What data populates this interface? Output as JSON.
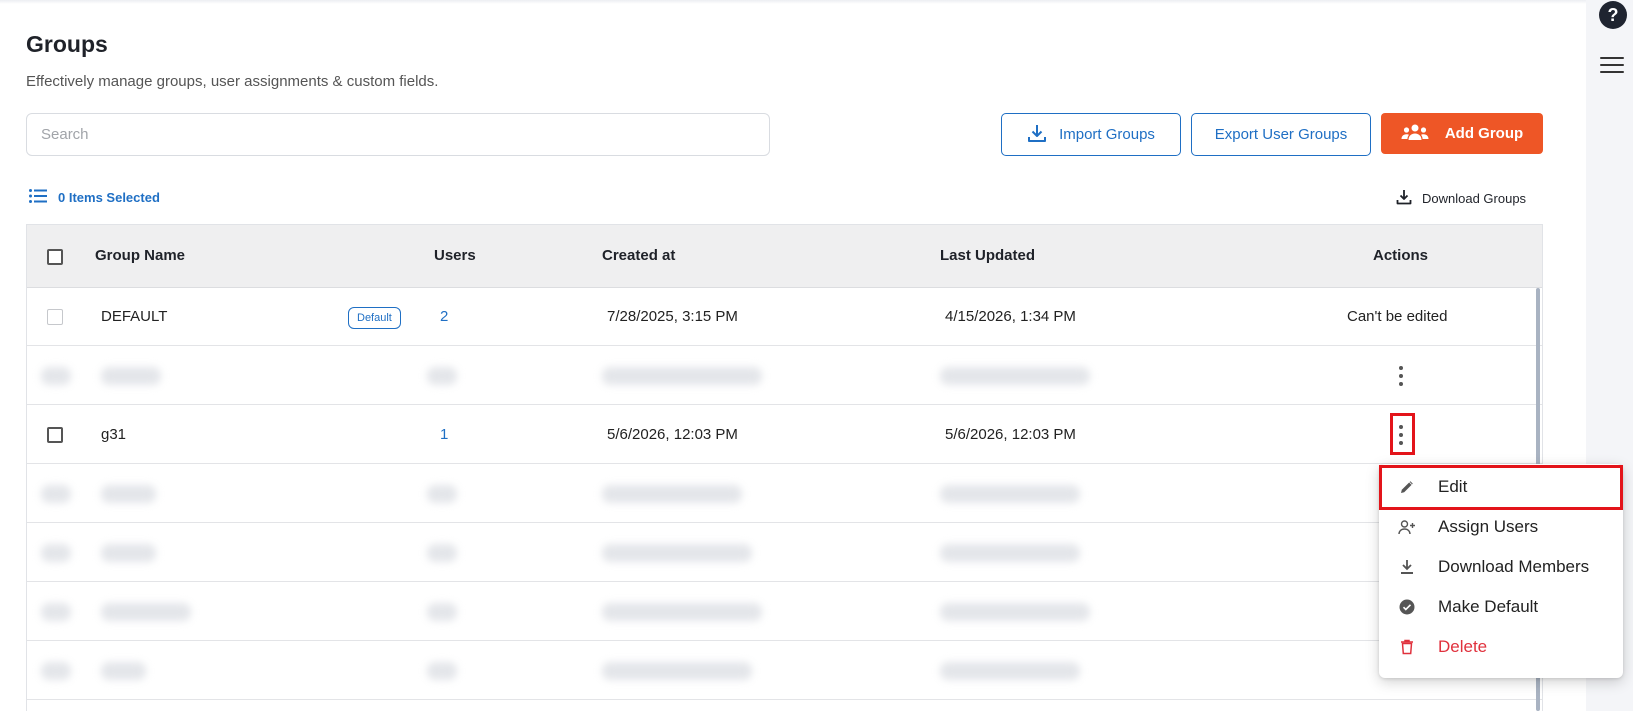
{
  "page": {
    "title": "Groups",
    "subtitle": "Effectively manage groups, user assignments & custom fields."
  },
  "search": {
    "placeholder": "Search",
    "value": ""
  },
  "toolbar": {
    "import_label": "Import Groups",
    "export_label": "Export User Groups",
    "add_label": "Add Group",
    "items_selected": "0 Items Selected",
    "download_label": "Download Groups"
  },
  "table": {
    "headers": {
      "group_name": "Group Name",
      "users": "Users",
      "created_at": "Created at",
      "last_updated": "Last Updated",
      "actions": "Actions"
    },
    "rows": [
      {
        "name": "DEFAULT",
        "badge": "Default",
        "users": "2",
        "created_at": "7/28/2025, 3:15 PM",
        "last_updated": "4/15/2026, 1:34 PM",
        "actions": "Can't be edited"
      },
      {
        "name": "g31",
        "users": "1",
        "created_at": "5/6/2026, 12:03 PM",
        "last_updated": "5/6/2026, 12:03 PM"
      }
    ]
  },
  "context_menu": {
    "items": [
      {
        "label": "Edit",
        "icon": "pencil-icon"
      },
      {
        "label": "Assign Users",
        "icon": "person-add-icon"
      },
      {
        "label": "Download Members",
        "icon": "download-icon"
      },
      {
        "label": "Make Default",
        "icon": "check-circle-icon"
      },
      {
        "label": "Delete",
        "icon": "trash-icon"
      }
    ]
  },
  "help": {
    "label": "?"
  },
  "colors": {
    "accent": "#1f6fc4",
    "primary_button": "#ee5626",
    "danger": "#e0313d",
    "highlight": "#e3141a"
  }
}
